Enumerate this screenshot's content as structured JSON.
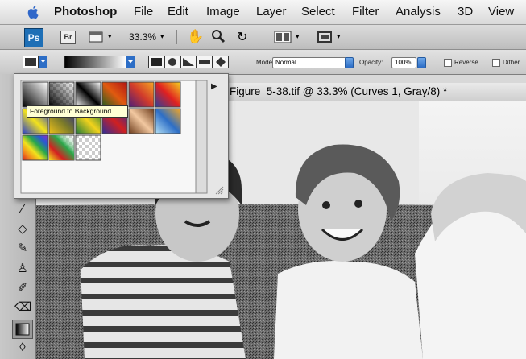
{
  "menubar": {
    "app_name": "Photoshop",
    "items": [
      "File",
      "Edit",
      "Image",
      "Layer",
      "Select",
      "Filter",
      "Analysis",
      "3D",
      "View"
    ]
  },
  "appbar": {
    "ps_label": "Ps",
    "bridge_label": "Br",
    "zoom": "33.3%"
  },
  "options": {
    "mode_label": "Mode:",
    "mode_value": "Normal",
    "opacity_label": "Opacity:",
    "opacity_value": "100%",
    "reverse_label": "Reverse",
    "dither_label": "Dither"
  },
  "document": {
    "title": "Figure_5-38.tif @ 33.3% (Curves 1, Gray/8) *"
  },
  "picker": {
    "tooltip": "Foreground to Background"
  },
  "icons": [
    "apple-icon",
    "hand-icon",
    "zoom-icon",
    "rotate-icon",
    "arrange-documents-icon",
    "screen-mode-icon",
    "panel-menu-arrow-icon",
    "resize-grip-icon"
  ],
  "colors": {
    "ps_blue": "#1e6fb6",
    "tooltip_bg": "#ffffd5"
  }
}
